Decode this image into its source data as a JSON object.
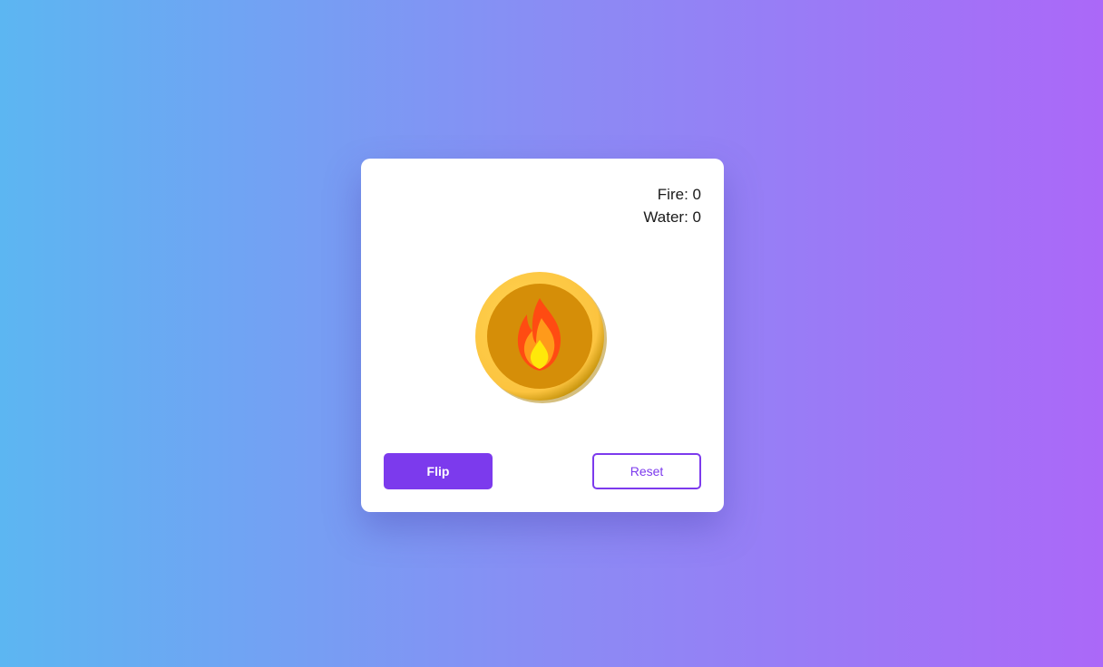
{
  "scoreboard": {
    "fire_label": "Fire:",
    "fire_count": "0",
    "water_label": "Water:",
    "water_count": "0"
  },
  "coin": {
    "current_face": "fire",
    "icon": "fire-icon",
    "colors": {
      "rim": "#fcc440",
      "face": "#d58e08",
      "flame_outer": "#ff4b12",
      "flame_middle": "#ff9a1a",
      "flame_inner": "#ffe80a"
    }
  },
  "controls": {
    "flip_label": "Flip",
    "reset_label": "Reset"
  },
  "theme": {
    "accent": "#7c3aed",
    "background_start": "#5cb6f2",
    "background_end": "#ab68f8"
  }
}
